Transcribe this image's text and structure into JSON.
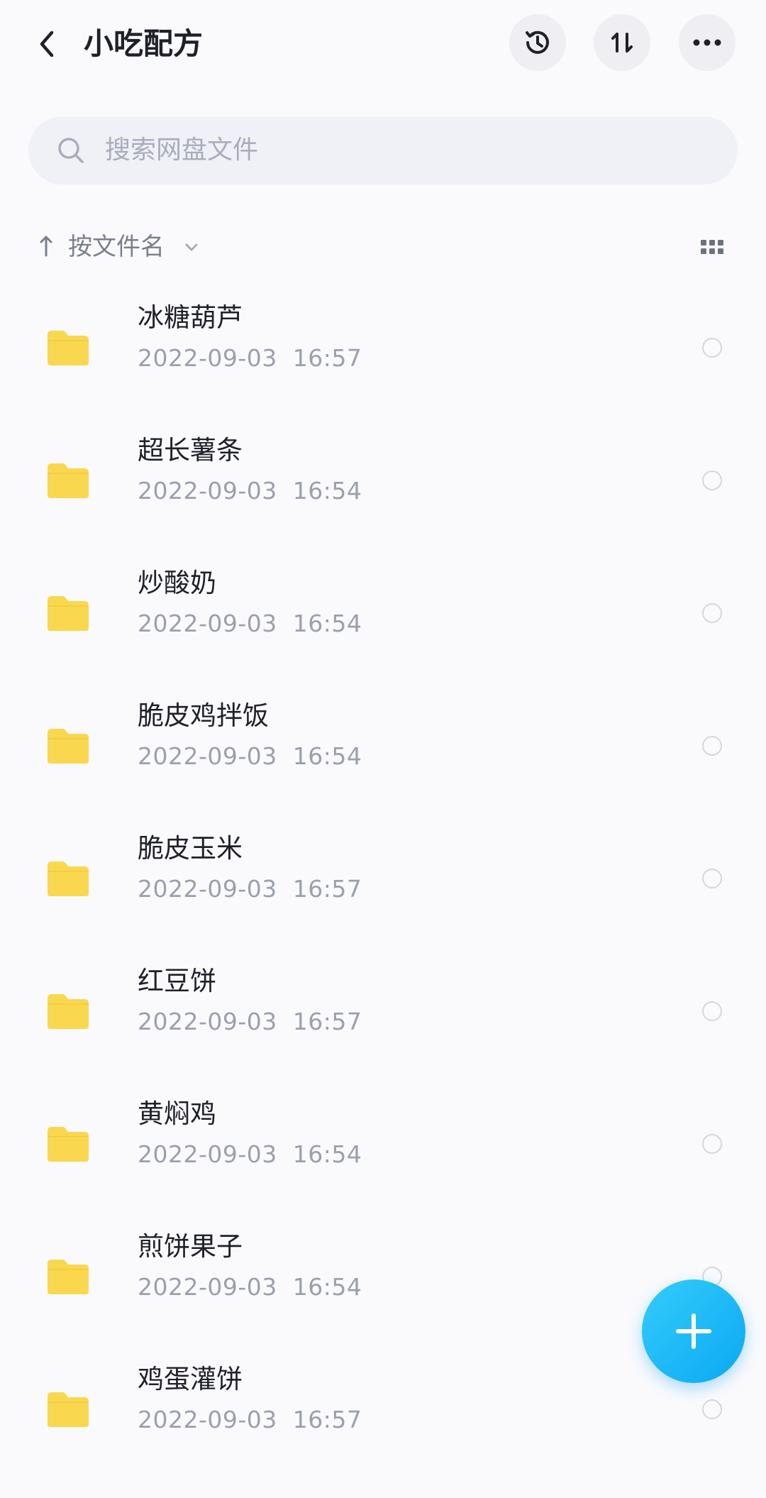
{
  "header": {
    "title": "小吃配方",
    "back_icon": "chevron-left-icon",
    "actions": [
      "history-icon",
      "sort-swap-icon",
      "more-icon"
    ]
  },
  "search": {
    "placeholder": "搜索网盘文件"
  },
  "sort": {
    "label": "按文件名",
    "direction_icon": "arrow-up-icon",
    "view_icon": "grid-view-icon"
  },
  "files": [
    {
      "name": "冰糖葫芦",
      "date": "2022-09-03  16:57"
    },
    {
      "name": "超长薯条",
      "date": "2022-09-03  16:54"
    },
    {
      "name": "炒酸奶",
      "date": "2022-09-03  16:54"
    },
    {
      "name": "脆皮鸡拌饭",
      "date": "2022-09-03  16:54"
    },
    {
      "name": "脆皮玉米",
      "date": "2022-09-03  16:57"
    },
    {
      "name": "红豆饼",
      "date": "2022-09-03  16:57"
    },
    {
      "name": "黄焖鸡",
      "date": "2022-09-03  16:54"
    },
    {
      "name": "煎饼果子",
      "date": "2022-09-03  16:54"
    },
    {
      "name": "鸡蛋灌饼",
      "date": "2022-09-03  16:57"
    }
  ],
  "colors": {
    "folder": "#f9d84f",
    "accent": "#1aafff",
    "background": "#fafafd"
  },
  "fab_icon": "plus-icon"
}
